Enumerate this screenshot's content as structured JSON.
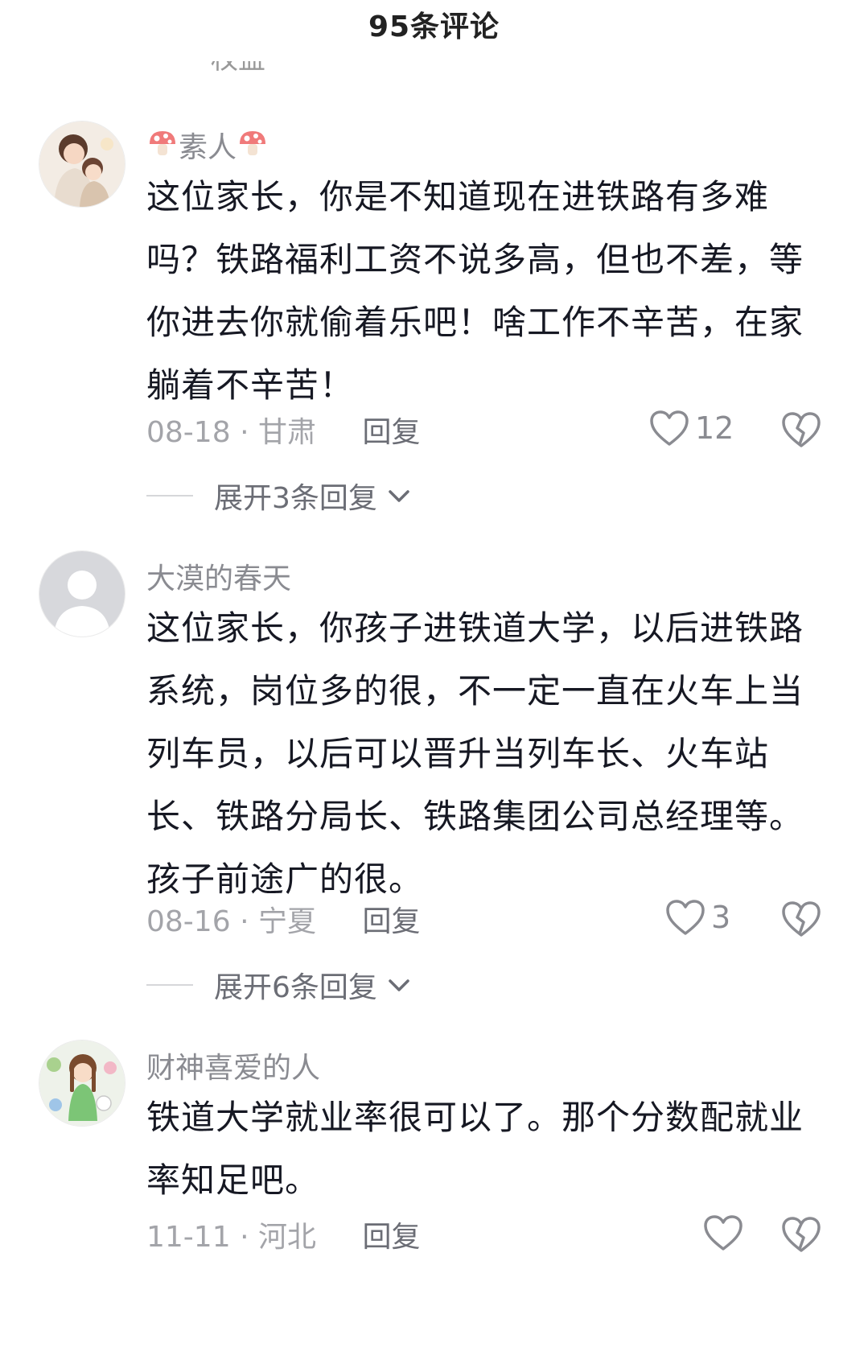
{
  "header": {
    "title": "95条评论"
  },
  "clipped_text": "权益",
  "comments": [
    {
      "username": "素人",
      "text": "这位家长，你是不知道现在进铁路有多难吗？铁路福利工资不说多高，但也不差，等你进去你就偷着乐吧！啥工作不辛苦，在家躺着不辛苦！",
      "date": "08-18",
      "location": "甘肃",
      "reply_label": "回复",
      "likes": "12",
      "expand_label": "展开3条回复"
    },
    {
      "username": "大漠的春天",
      "text": "这位家长，你孩子进铁道大学，以后进铁路系统，岗位多的很，不一定一直在火车上当列车员，以后可以晋升当列车长、火车站长、铁路分局长、铁路集团公司总经理等。孩子前途广的很。",
      "date": "08-16",
      "location": "宁夏",
      "reply_label": "回复",
      "likes": "3",
      "expand_label": "展开6条回复"
    },
    {
      "username": "财神喜爱的人",
      "text": "铁道大学就业率很可以了。那个分数配就业率知足吧。",
      "date": "11-11",
      "location": "河北",
      "reply_label": "回复",
      "likes": ""
    }
  ],
  "separator": "·",
  "colors": {
    "username": "#8a8b91",
    "text": "#161823",
    "meta": "#a3a4a9",
    "icon": "#8a8b91",
    "mushroom": "#f07a7a"
  },
  "icons": {
    "like": "heart-outline-icon",
    "dislike": "broken-heart-icon",
    "expand": "chevron-down-icon",
    "username_decoration": "mushroom-icon"
  }
}
